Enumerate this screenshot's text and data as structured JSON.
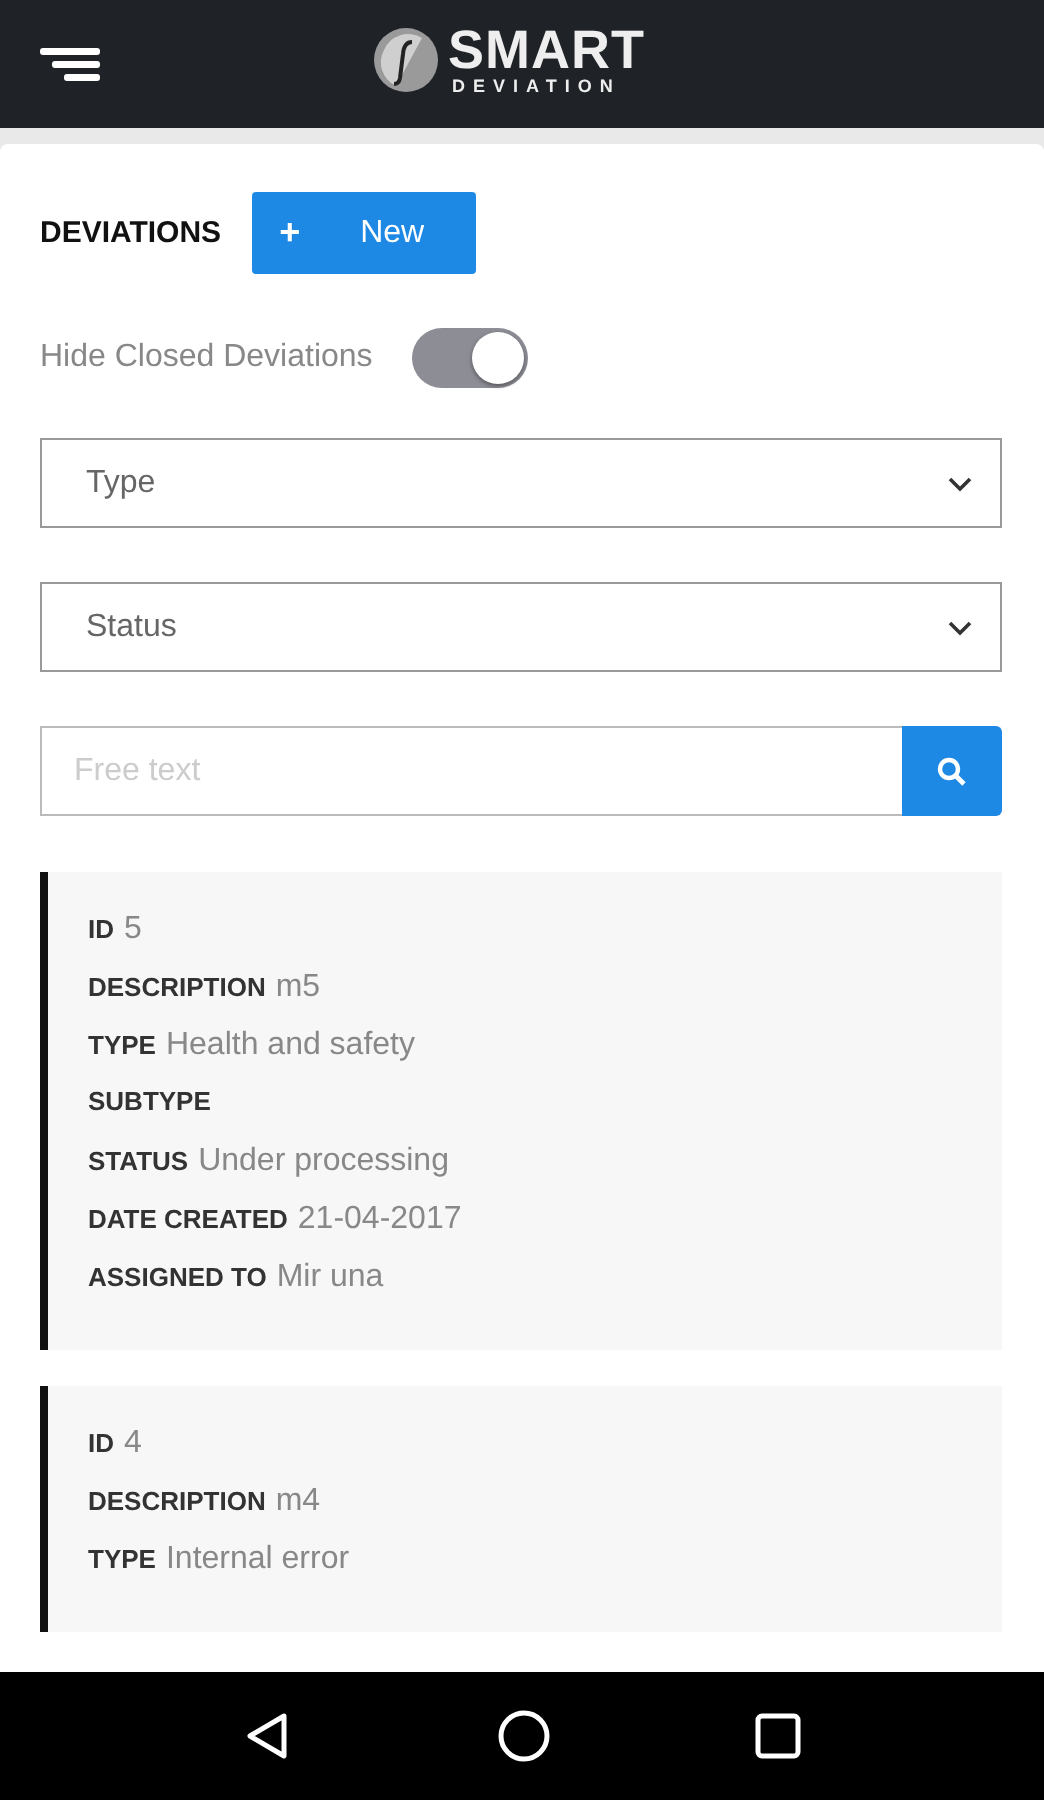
{
  "header": {
    "logo_top": "SMART",
    "logo_bottom": "DEVIATION"
  },
  "title": "DEVIATIONS",
  "new_button": {
    "icon": "+",
    "label": "New"
  },
  "hide_closed": {
    "label": "Hide Closed Deviations",
    "on": true
  },
  "filters": [
    {
      "placeholder": "Type"
    },
    {
      "placeholder": "Status"
    }
  ],
  "search": {
    "placeholder": "Free text"
  },
  "deviations": [
    {
      "fields": [
        {
          "label": "ID",
          "value": "5"
        },
        {
          "label": "DESCRIPTION",
          "value": "m5"
        },
        {
          "label": "TYPE",
          "value": "Health and safety"
        },
        {
          "label": "SUBTYPE"
        },
        {
          "label": "STATUS",
          "value": "Under processing"
        },
        {
          "label": "DATE CREATED",
          "value": "21-04-2017"
        },
        {
          "label": "ASSIGNED TO",
          "value": "Mir una"
        }
      ]
    },
    {
      "fields": [
        {
          "label": "ID",
          "value": "4"
        },
        {
          "label": "DESCRIPTION",
          "value": "m4"
        },
        {
          "label": "TYPE",
          "value": "Internal error"
        }
      ]
    }
  ]
}
